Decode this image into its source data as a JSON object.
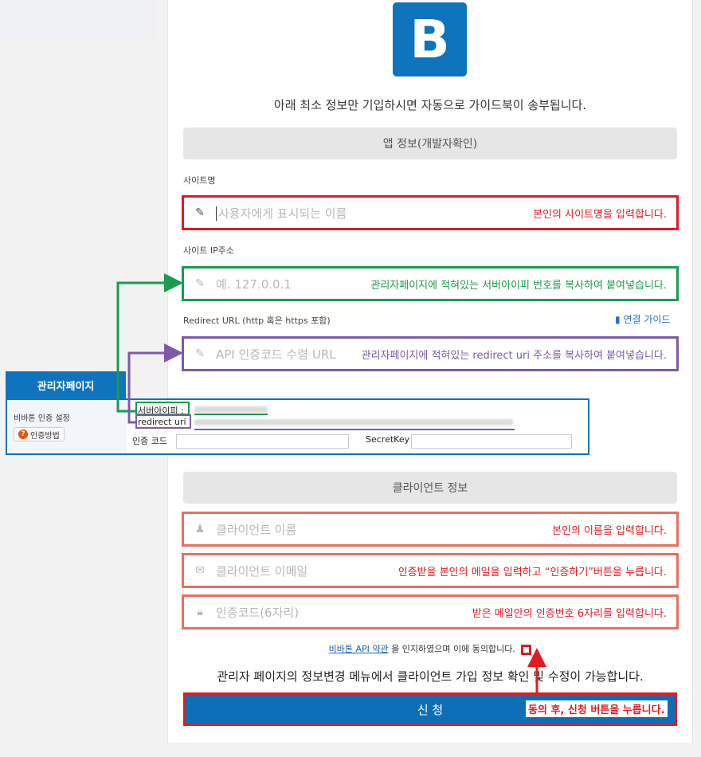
{
  "logo": {
    "letter": "B"
  },
  "intro": "아래 최소 정보만 기입하시면 자동으로 가이드북이 송부됩니다.",
  "app_section": "앱 정보(개발자확인)",
  "site_name": {
    "label": "사이트명",
    "placeholder": "사용자에게 표시되는 이름",
    "note": "본인의 사이트명을 입력합니다."
  },
  "site_ip": {
    "label": "사이트 IP주소",
    "placeholder": "예. 127.0.0.1",
    "note": "관리자페이지에 적혀있는 서버아이피 번호를 복사하여 붙여넣습니다."
  },
  "redirect": {
    "label": "Redirect URL (http 혹은 https 포함)",
    "guide": "연결 가이드",
    "placeholder": "API 인증코드 수령 URL",
    "note": "관리자페이지에 적혀있는 redirect uri 주소를 복사하여 붙여넣습니다."
  },
  "admin": {
    "tab": "관리자페이지",
    "title": "비바톤 인증 설정",
    "how_button": "인증방법",
    "server_ip_label": "서버아이피 :",
    "redirect_label": "redirect uri :",
    "auth_code_label": "인증 코드",
    "secret_label": "SecretKey"
  },
  "client_section": "클라이언트 정보",
  "client_name": {
    "placeholder": "클라이언트 이름",
    "note": "본인의 이름을 입력합니다."
  },
  "client_email": {
    "placeholder": "클라이언트 이메일",
    "note": "인증받을 본인의 메일을 입력하고 “인증하기”버튼을 누릅니다."
  },
  "client_code": {
    "placeholder": "인증코드(6자리)",
    "note": "받은 메일안의 인증번호 6자리를 입력합니다."
  },
  "agree": {
    "link": "비바톤 API 약관",
    "text": "을 인지하였으며 이에 동의합니다."
  },
  "bottom_info": "관리자 페이지의 정보변경 메뉴에서 클라이언트 가입 정보 확인 및 수정이 가능합니다.",
  "submit": {
    "label": "신 청",
    "note": "동의 후, 신청 버튼을 누릅니다."
  },
  "colors": {
    "brand": "#0d74bd",
    "red": "#e11b22",
    "green": "#1a9c4f",
    "purple": "#7b5ba8",
    "salmon": "#e87060"
  }
}
